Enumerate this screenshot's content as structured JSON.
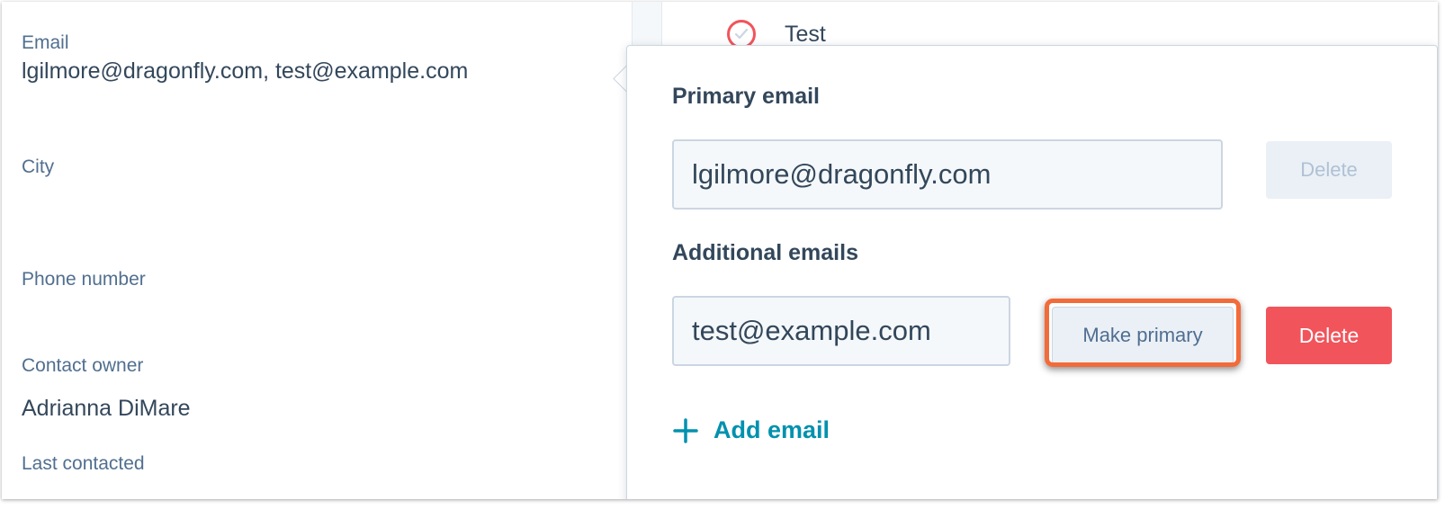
{
  "properties": {
    "email_label": "Email",
    "email_value": "lgilmore@dragonfly.com, test@example.com",
    "city_label": "City",
    "phone_label": "Phone number",
    "owner_label": "Contact owner",
    "owner_value": "Adrianna DiMare",
    "last_contacted_label": "Last contacted"
  },
  "background_task": {
    "title": "Test",
    "icon": "task-complete-check-icon"
  },
  "popover": {
    "primary_heading": "Primary email",
    "primary_email": "lgilmore@dragonfly.com",
    "primary_delete_label": "Delete",
    "additional_heading": "Additional emails",
    "additional_email": "test@example.com",
    "make_primary_label": "Make primary",
    "additional_delete_label": "Delete",
    "add_email_label": "Add email"
  },
  "colors": {
    "accent_link": "#0091ae",
    "danger": "#f2545b",
    "highlight_outline": "#f26b3a",
    "text_primary": "#33475b",
    "text_label": "#516f90"
  }
}
